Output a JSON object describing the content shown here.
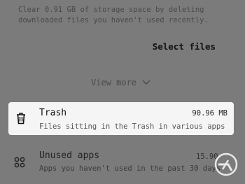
{
  "description": "Clear 0.91 GB of storage space by deleting downloaded files you haven't used recently.",
  "select_files_label": "Select files",
  "view_more_label": "View more",
  "trash": {
    "title": "Trash",
    "size": "90.96 MB",
    "subtitle": "Files sitting in the Trash in various apps",
    "icon": "trash-icon"
  },
  "unused_apps": {
    "title": "Unused apps",
    "size": "15.90",
    "subtitle": "Apps you haven't used in the past 30 days",
    "icon": "apps-grid-icon"
  },
  "watermark_icon": "watermark-logo-icon",
  "colors": {
    "dim_overlay": "#7b7b7b",
    "card_background": "#f5f5f5"
  }
}
